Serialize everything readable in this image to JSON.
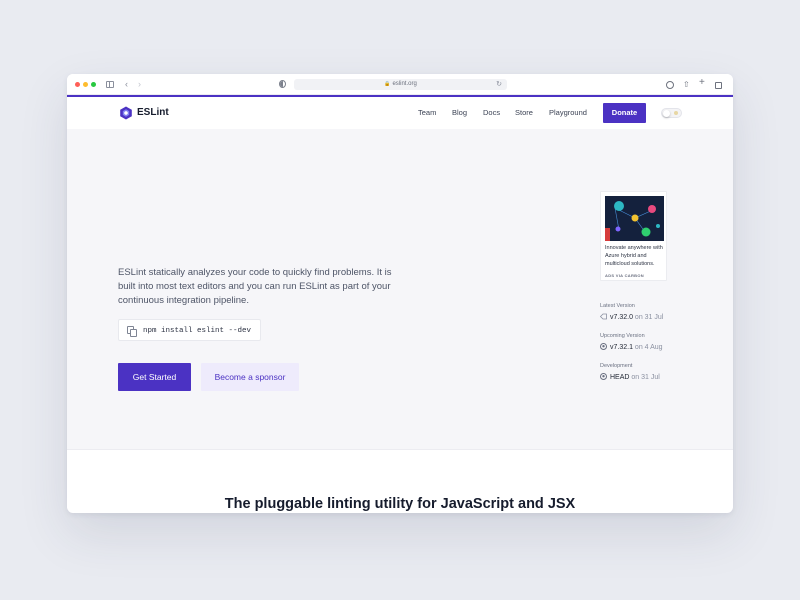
{
  "browser": {
    "url": "eslint.org",
    "icons": [
      "sidebar-icon",
      "back-icon",
      "forward-icon",
      "shield-icon",
      "lock-icon",
      "reload-icon",
      "download-icon",
      "share-icon",
      "new-tab-icon",
      "tabs-overview-icon"
    ]
  },
  "header": {
    "brand": "ESLint",
    "nav": [
      "Team",
      "Blog",
      "Docs",
      "Store",
      "Playground"
    ],
    "donate": "Donate"
  },
  "hero": {
    "description": "ESLint statically analyzes your code to quickly find problems. It is built into most text editors and you can run ESLint as part of your continuous integration pipeline.",
    "install_command": "npm install eslint --dev",
    "primary_cta": "Get Started",
    "secondary_cta": "Become a sponsor"
  },
  "ad": {
    "text": "Innovate anywhere with Azure hybrid and multicloud solutions.",
    "via": "ADS VIA CARBON"
  },
  "versions": [
    {
      "label": "Latest Version",
      "version": "v7.32.0",
      "date": "on 31 Jul",
      "icon": "tag-icon"
    },
    {
      "label": "Upcoming Version",
      "version": "v7.32.1",
      "date": "on 4 Aug",
      "icon": "github-icon"
    },
    {
      "label": "Development",
      "version": "HEAD",
      "date": "on 31 Jul",
      "icon": "github-icon"
    }
  ],
  "tagline": "The pluggable linting utility for JavaScript and JSX",
  "colors": {
    "accent": "#4b32c3",
    "accent_light": "#eeebfc",
    "hero_bg": "#f6f6f9",
    "page_bg": "#e9ebf1"
  }
}
